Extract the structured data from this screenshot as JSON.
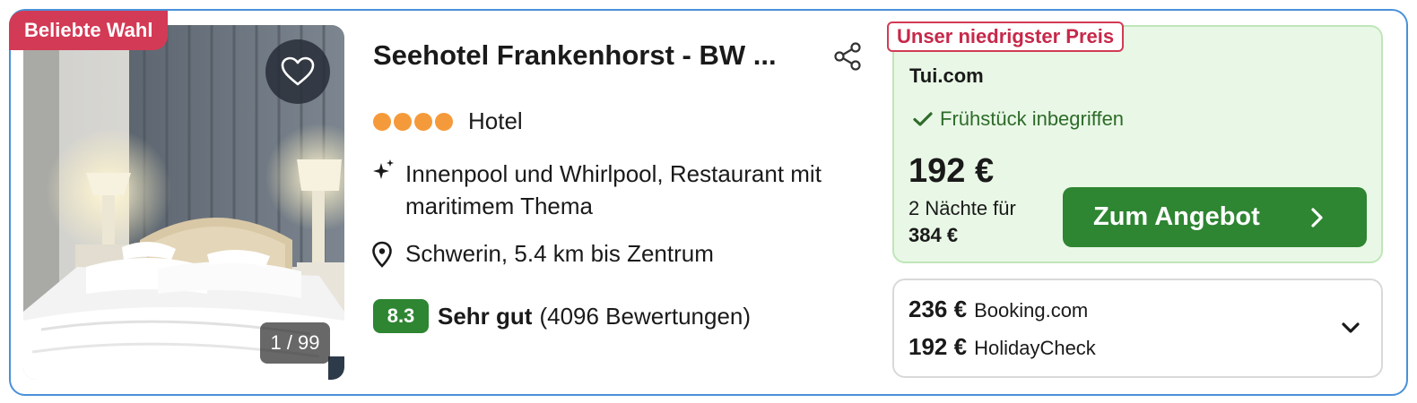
{
  "badge": {
    "label": "Beliebte Wahl"
  },
  "photo": {
    "counter": "1 / 99"
  },
  "hotel": {
    "title": "Seehotel Frankenhorst - BW ...",
    "stars": 4,
    "type": "Hotel",
    "feature": "Innenpool und Whirlpool, Restaurant mit maritimem Thema",
    "location": "Schwerin, 5.4 km bis Zentrum",
    "rating": {
      "score": "8.3",
      "label": "Sehr gut",
      "count": "(4096 Bewertungen)"
    }
  },
  "offer": {
    "badge": "Unser niedrigster Preis",
    "provider": "Tui.com",
    "breakfast": "Frühstück inbegriffen",
    "price": "192 €",
    "nights": "2 Nächte für",
    "total": "384 €",
    "cta": "Zum Angebot"
  },
  "alternatives": [
    {
      "price": "236 €",
      "provider": "Booking.com"
    },
    {
      "price": "192 €",
      "provider": "HolidayCheck"
    }
  ],
  "colors": {
    "accent_green": "#2e8532",
    "badge_red": "#d33a55",
    "star_orange": "#f59a3a",
    "offer_bg": "#e9f8e6",
    "card_border": "#4a90d9"
  },
  "icons": [
    "heart-icon",
    "share-icon",
    "sparkle-icon",
    "location-pin-icon",
    "check-icon",
    "chevron-right-icon",
    "chevron-down-icon"
  ]
}
